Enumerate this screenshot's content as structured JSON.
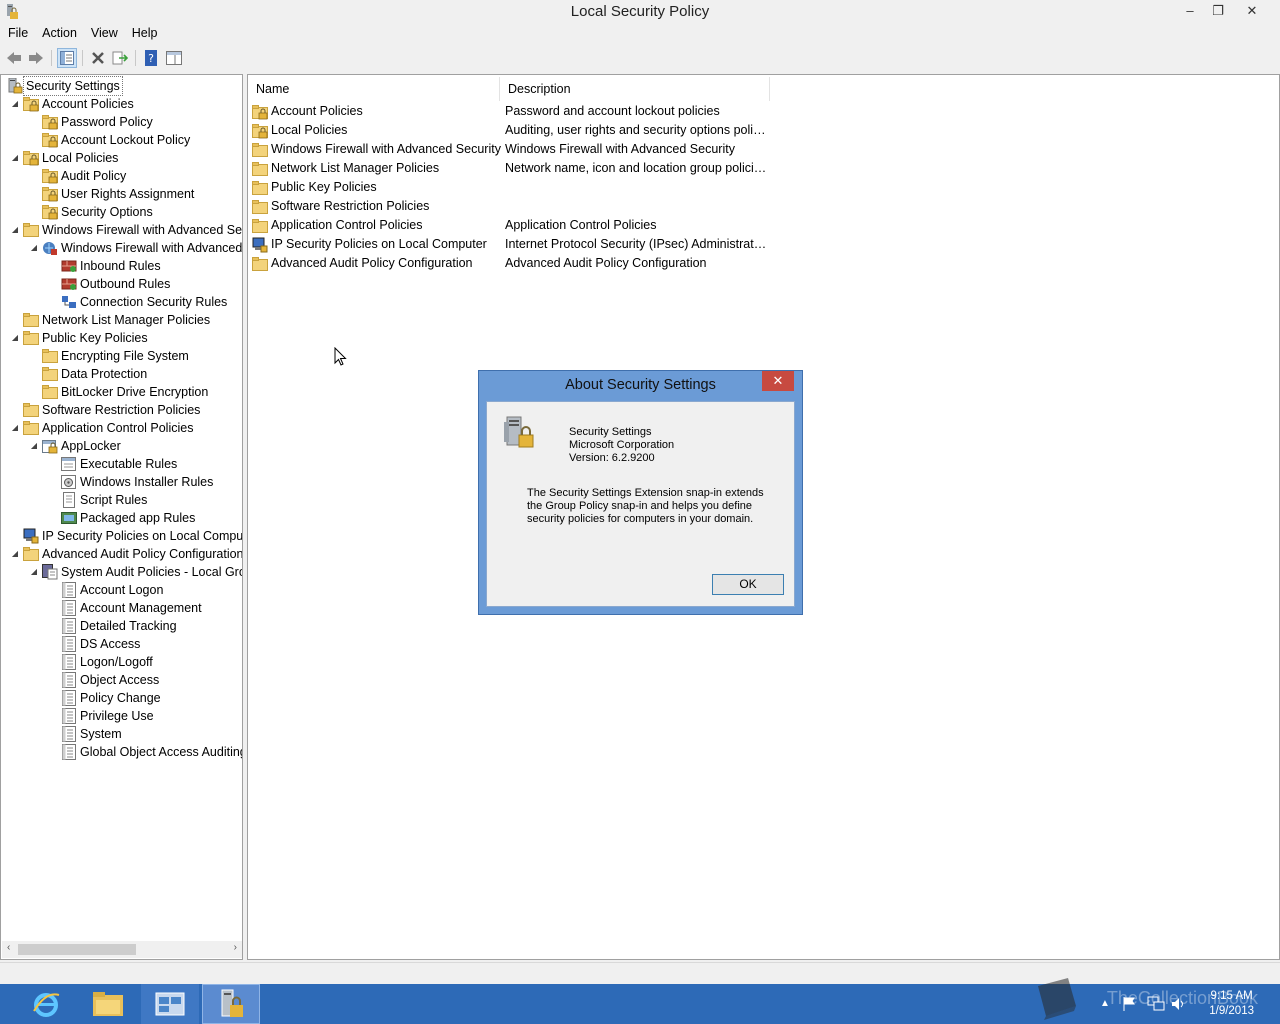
{
  "window": {
    "title": "Local Security Policy"
  },
  "window_controls": {
    "minimize": "–",
    "restore": "❐",
    "close": "✕"
  },
  "menu": {
    "file": "File",
    "action": "Action",
    "view": "View",
    "help": "Help"
  },
  "tree": {
    "items": [
      {
        "label": "Security Settings"
      },
      {
        "label": "Account Policies"
      },
      {
        "label": "Password Policy"
      },
      {
        "label": "Account Lockout Policy"
      },
      {
        "label": "Local Policies"
      },
      {
        "label": "Audit Policy"
      },
      {
        "label": "User Rights Assignment"
      },
      {
        "label": "Security Options"
      },
      {
        "label": "Windows Firewall with Advanced Secu"
      },
      {
        "label": "Windows Firewall with Advanced"
      },
      {
        "label": "Inbound Rules"
      },
      {
        "label": "Outbound Rules"
      },
      {
        "label": "Connection Security Rules"
      },
      {
        "label": "Network List Manager Policies"
      },
      {
        "label": "Public Key Policies"
      },
      {
        "label": "Encrypting File System"
      },
      {
        "label": "Data Protection"
      },
      {
        "label": "BitLocker Drive Encryption"
      },
      {
        "label": "Software Restriction Policies"
      },
      {
        "label": "Application Control Policies"
      },
      {
        "label": "AppLocker"
      },
      {
        "label": "Executable Rules"
      },
      {
        "label": "Windows Installer Rules"
      },
      {
        "label": "Script Rules"
      },
      {
        "label": "Packaged app Rules"
      },
      {
        "label": "IP Security Policies on Local Compute"
      },
      {
        "label": "Advanced Audit Policy Configuration"
      },
      {
        "label": "System Audit Policies - Local Grou"
      },
      {
        "label": "Account Logon"
      },
      {
        "label": "Account Management"
      },
      {
        "label": "Detailed Tracking"
      },
      {
        "label": "DS Access"
      },
      {
        "label": "Logon/Logoff"
      },
      {
        "label": "Object Access"
      },
      {
        "label": "Policy Change"
      },
      {
        "label": "Privilege Use"
      },
      {
        "label": "System"
      },
      {
        "label": "Global Object Access Auditing"
      }
    ]
  },
  "list": {
    "columns": {
      "name": "Name",
      "description": "Description"
    },
    "rows": [
      {
        "name": "Account Policies",
        "description": "Password and account lockout policies"
      },
      {
        "name": "Local Policies",
        "description": "Auditing, user rights and security options polici..."
      },
      {
        "name": "Windows Firewall with Advanced Security",
        "description": "Windows Firewall with Advanced Security"
      },
      {
        "name": "Network List Manager Policies",
        "description": "Network name, icon and location group policies."
      },
      {
        "name": "Public Key Policies",
        "description": ""
      },
      {
        "name": "Software Restriction Policies",
        "description": ""
      },
      {
        "name": "Application Control Policies",
        "description": "Application Control Policies"
      },
      {
        "name": "IP Security Policies on Local Computer",
        "description": "Internet Protocol Security (IPsec) Administratio..."
      },
      {
        "name": "Advanced Audit Policy Configuration",
        "description": "Advanced Audit Policy Configuration"
      }
    ]
  },
  "dialog": {
    "title": "About Security Settings",
    "close": "✕",
    "product": "Security Settings",
    "company": "Microsoft Corporation",
    "version": "Version: 6.2.9200",
    "description": "The Security Settings Extension snap-in extends the Group Policy snap-in and helps you define security policies for computers in your domain.",
    "ok": "OK"
  },
  "taskbar": {
    "clock_time": "9:15 AM",
    "clock_date": "1/9/2013",
    "watermark": "TheCollectionBook"
  }
}
